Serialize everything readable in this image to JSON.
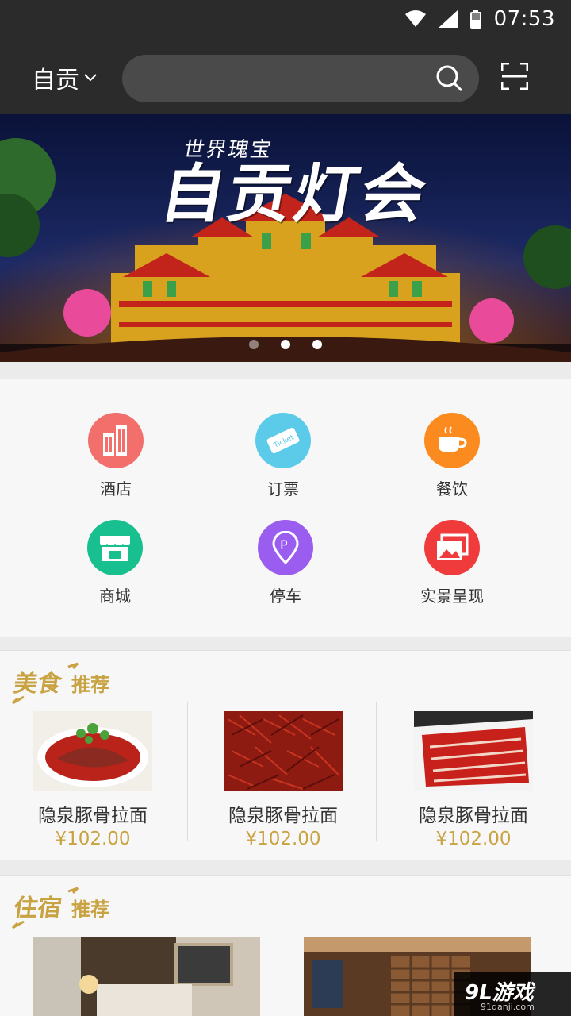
{
  "status": {
    "time": "07:53"
  },
  "header": {
    "city": "自贡",
    "search_placeholder": ""
  },
  "banner": {
    "title": "自贡灯会",
    "subtitle": "世界瑰宝",
    "slide_count": 3,
    "active_slide": 2
  },
  "categories": [
    {
      "label": "酒店",
      "icon": "hotel-icon",
      "color": "#f26f6b"
    },
    {
      "label": "订票",
      "icon": "ticket-icon",
      "color": "#5ccbea"
    },
    {
      "label": "餐饮",
      "icon": "coffee-cup-icon",
      "color": "#fb8b1f"
    },
    {
      "label": "商城",
      "icon": "shop-icon",
      "color": "#17c08e"
    },
    {
      "label": "停车",
      "icon": "parking-pin-icon",
      "color": "#9a5df0"
    },
    {
      "label": "实景呈现",
      "icon": "photo-gallery-icon",
      "color": "#ef3b3b"
    }
  ],
  "food_section": {
    "title_main": "美食",
    "title_sub": "推荐",
    "items": [
      {
        "name": "隐泉豚骨拉面",
        "price": "¥102.00"
      },
      {
        "name": "隐泉豚骨拉面",
        "price": "¥102.00"
      },
      {
        "name": "隐泉豚骨拉面",
        "price": "¥102.00"
      }
    ]
  },
  "stay_section": {
    "title_main": "住宿",
    "title_sub": "推荐"
  },
  "watermark": {
    "main": "9L游戏",
    "sub": "91danji.com"
  },
  "colors": {
    "bar_bg": "#2b2b2b",
    "gold": "#c9a241"
  }
}
